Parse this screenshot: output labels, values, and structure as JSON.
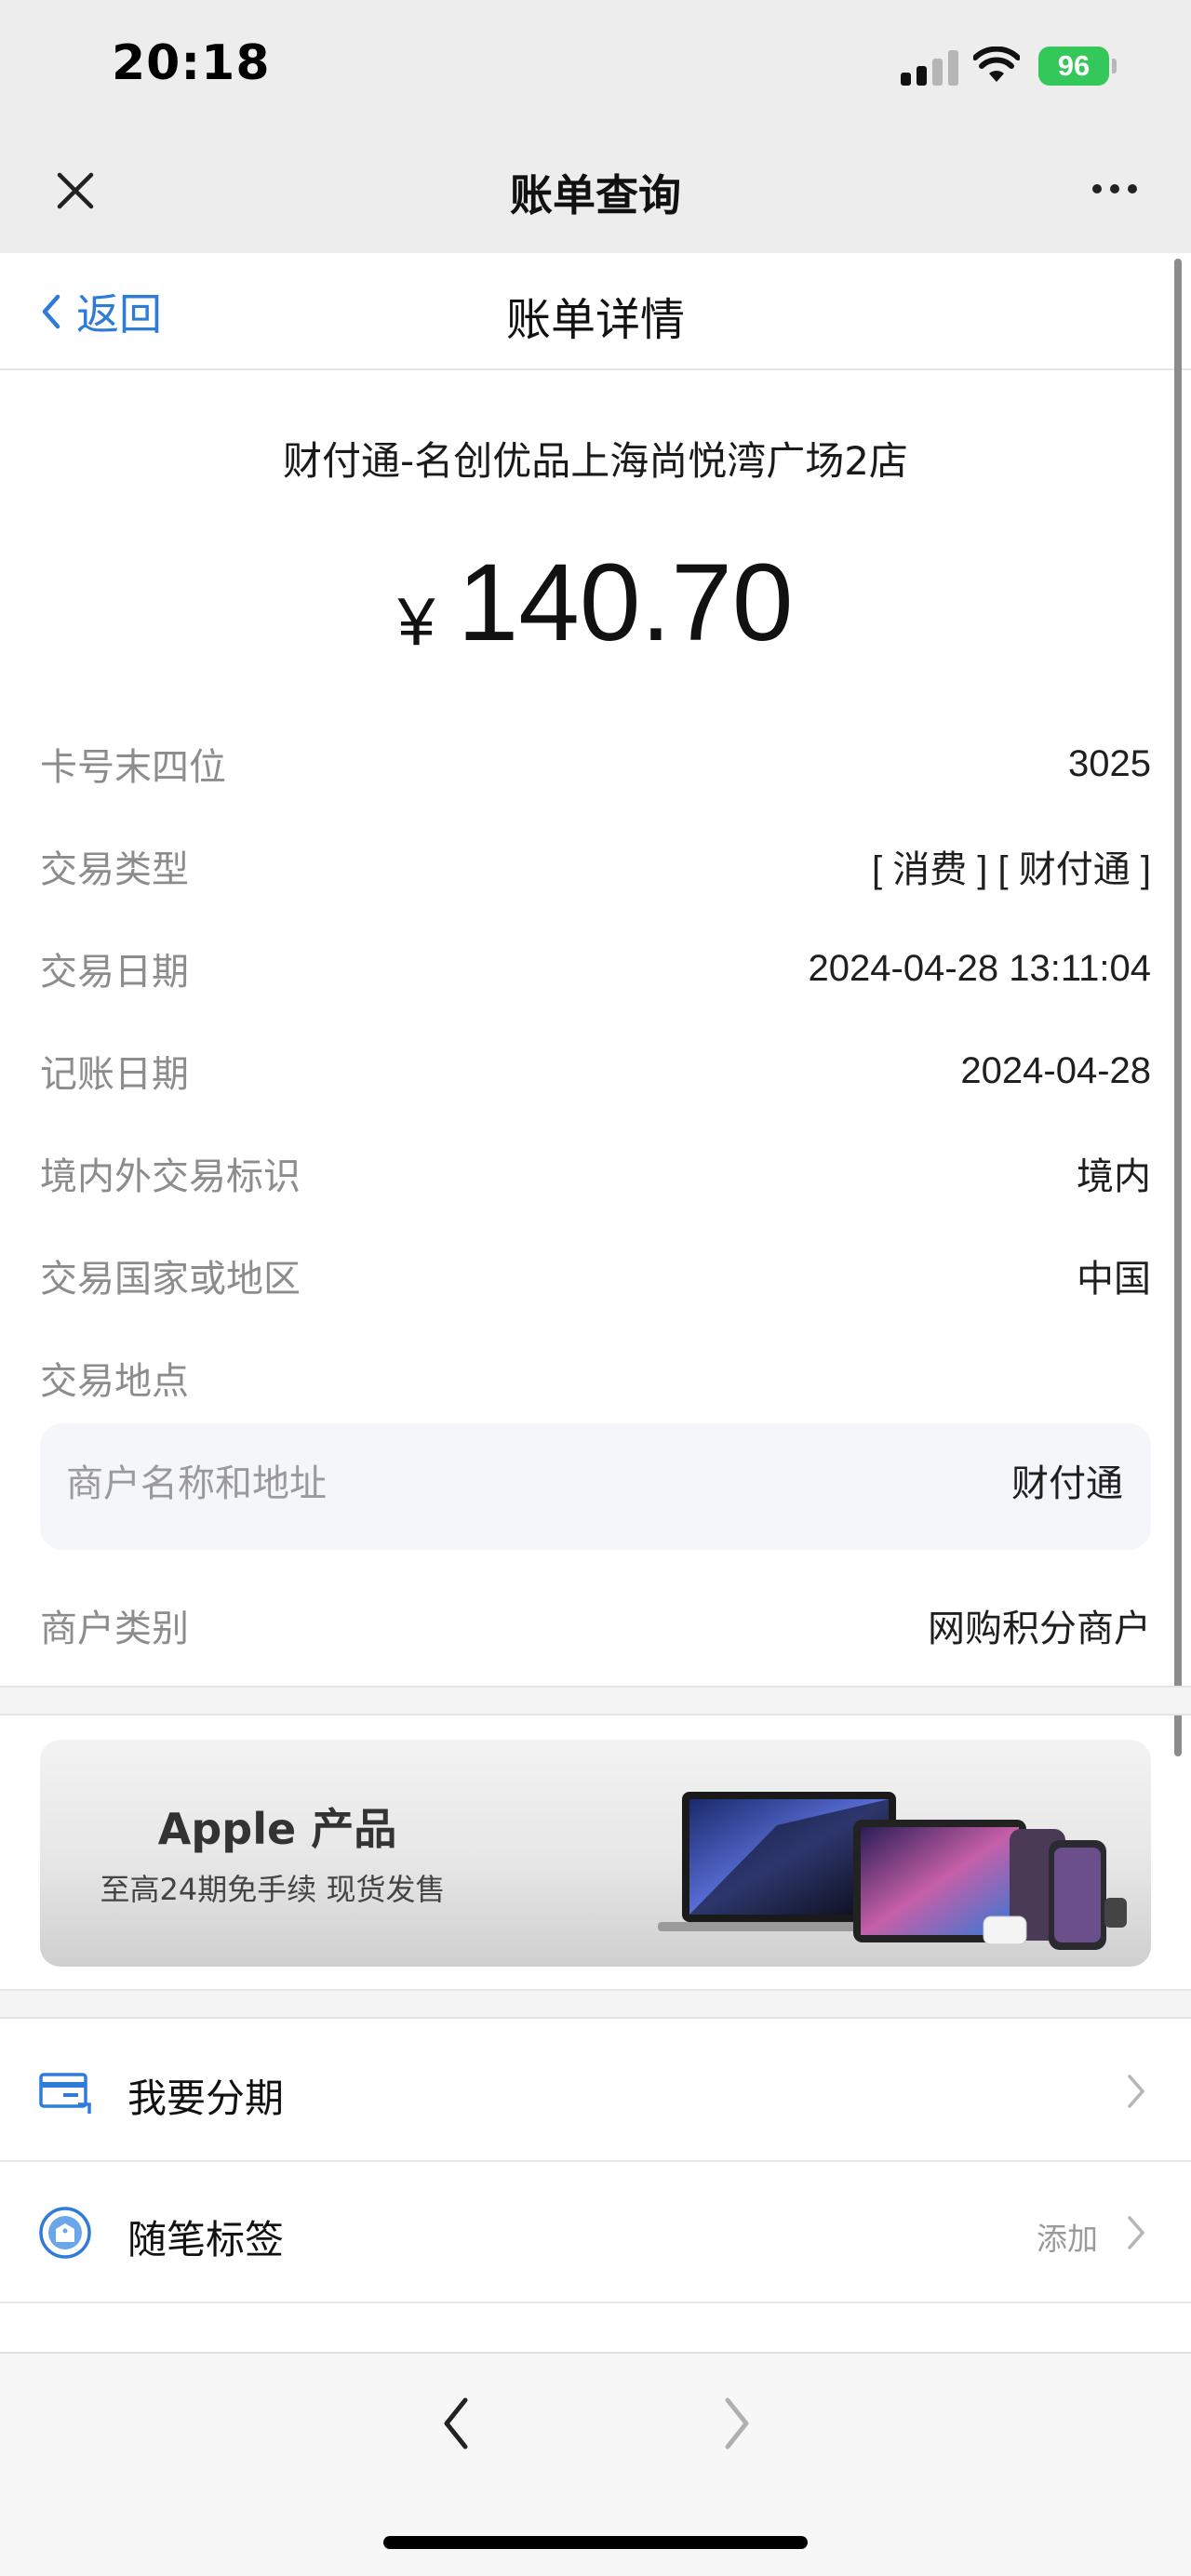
{
  "status_bar": {
    "time": "20:18",
    "battery": "96"
  },
  "nav": {
    "title": "账单查询"
  },
  "header": {
    "back_label": "返回",
    "title": "账单详情"
  },
  "bill": {
    "merchant": "财付通-名创优品上海尚悦湾广场2店",
    "currency": "¥",
    "amount": "140.70",
    "rows": [
      {
        "label": "卡号末四位",
        "value": "3025"
      },
      {
        "label": "交易类型",
        "value": "[ 消费 ] [ 财付通 ]"
      },
      {
        "label": "交易日期",
        "value": "2024-04-28 13:11:04"
      },
      {
        "label": "记账日期",
        "value": "2024-04-28"
      },
      {
        "label": "境内外交易标识",
        "value": "境内"
      },
      {
        "label": "交易国家或地区",
        "value": "中国"
      },
      {
        "label": "交易地点",
        "value": ""
      }
    ],
    "merchant_box": {
      "label": "商户名称和地址",
      "value": "财付通"
    },
    "category": {
      "label": "商户类别",
      "value": "网购积分商户"
    }
  },
  "banner": {
    "title": "Apple 产品",
    "subtitle": "至高24期免手续 现货发售"
  },
  "actions": {
    "installment": {
      "label": "我要分期"
    },
    "tag": {
      "label": "随笔标签",
      "hint": "添加"
    }
  },
  "colors": {
    "accent": "#2f7bd8",
    "battery": "#34c759"
  },
  "icons": [
    "close-icon",
    "more-icon",
    "back-chevron-icon",
    "installment-icon",
    "tag-icon",
    "chevron-right-icon"
  ]
}
